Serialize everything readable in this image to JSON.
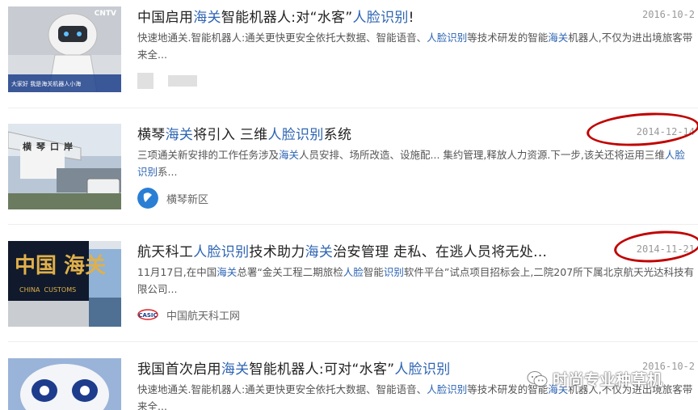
{
  "results": [
    {
      "title_parts": [
        {
          "text": "中国启用",
          "hl": false
        },
        {
          "text": "海关",
          "hl": true
        },
        {
          "text": "智能机器人:对“水客”",
          "hl": false
        },
        {
          "text": "人脸识别",
          "hl": true
        },
        {
          "text": "!",
          "hl": false
        }
      ],
      "date": "2016-10-2",
      "desc_parts": [
        {
          "text": "快速地通关.智能机器人:通关更快更安全依托大数据、智能语音、",
          "hl": false
        },
        {
          "text": "人脸识别",
          "hl": true
        },
        {
          "text": "等技术研发的智能",
          "hl": false
        },
        {
          "text": "海关",
          "hl": true
        },
        {
          "text": "机器人,不仅为进出境旅客带来全...",
          "hl": false
        }
      ],
      "thumb_caption": "大家好 我是海关机器人小海",
      "thumb_logo": "CNTV"
    },
    {
      "title_parts": [
        {
          "text": "横琴",
          "hl": false
        },
        {
          "text": "海关",
          "hl": true
        },
        {
          "text": "将引入 三维",
          "hl": false
        },
        {
          "text": "人脸识别",
          "hl": true
        },
        {
          "text": "系统",
          "hl": false
        }
      ],
      "date": "2014-12-14",
      "desc_parts": [
        {
          "text": "三项通关新安排的工作任务涉及",
          "hl": false
        },
        {
          "text": "海关",
          "hl": true
        },
        {
          "text": "人员安排、场所改造、设施配... 集约管理,释放人力资源.下一步,该关还将运用三维",
          "hl": false
        },
        {
          "text": "人脸识别",
          "hl": true
        },
        {
          "text": "系...",
          "hl": false
        }
      ],
      "source_name": "横琴新区",
      "thumb_sign": "横琴口岸"
    },
    {
      "title_parts": [
        {
          "text": "航天科工",
          "hl": false
        },
        {
          "text": "人脸识别",
          "hl": true
        },
        {
          "text": "技术助力",
          "hl": false
        },
        {
          "text": "海关",
          "hl": true
        },
        {
          "text": "治安管理 走私、在逃人员将无处...",
          "hl": false
        }
      ],
      "date": "2014-11-21",
      "desc_parts": [
        {
          "text": "11月17日,在中国",
          "hl": false
        },
        {
          "text": "海关",
          "hl": true
        },
        {
          "text": "总署“金关工程二期旅检",
          "hl": false
        },
        {
          "text": "人脸",
          "hl": true
        },
        {
          "text": "智能",
          "hl": false
        },
        {
          "text": "识别",
          "hl": true
        },
        {
          "text": "软件平台”试点项目招标会上,二院207所下属北京航天光达科技有限公司...",
          "hl": false
        }
      ],
      "source_name": "中国航天科工网",
      "thumb_sign_cn": "中国 海关",
      "thumb_sign_en": "CHINA  CUSTOMS"
    },
    {
      "title_parts": [
        {
          "text": "我国首次启用",
          "hl": false
        },
        {
          "text": "海关",
          "hl": true
        },
        {
          "text": "智能机器人:可对“水客”",
          "hl": false
        },
        {
          "text": "人脸识别",
          "hl": true
        }
      ],
      "date": "2016-10-2",
      "desc_parts": [
        {
          "text": "快速地通关.智能机器人:通关更快更安全依托大数据、智能语音、",
          "hl": false
        },
        {
          "text": "人脸识别",
          "hl": true
        },
        {
          "text": "等技术研发的智能",
          "hl": false
        },
        {
          "text": "海关",
          "hl": true
        },
        {
          "text": "机器人,不仅为进出境旅客带来全...",
          "hl": false
        }
      ]
    }
  ],
  "watermark": {
    "text": "时尚专业种草机",
    "icon": "wechat-icon"
  },
  "colors": {
    "highlight": "#2d64b3",
    "date": "#999999",
    "annotation": "#c00000"
  }
}
